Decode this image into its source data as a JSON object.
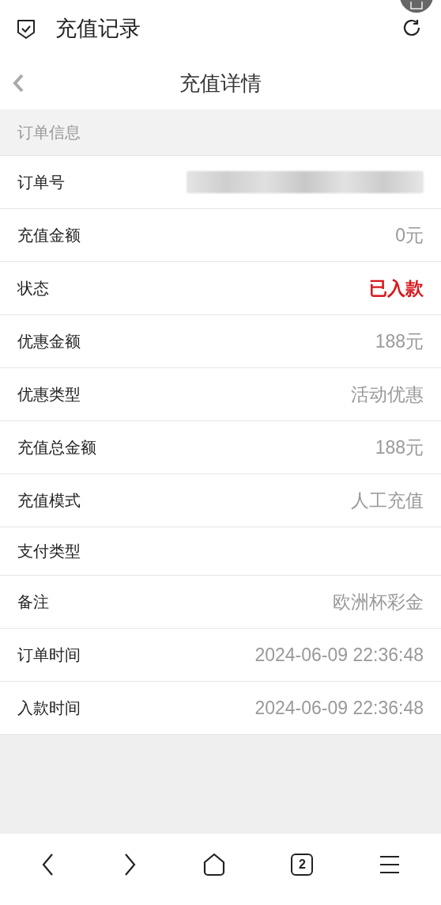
{
  "app_bar": {
    "title": "充值记录"
  },
  "header": {
    "title": "充值详情"
  },
  "section": {
    "title": "订单信息"
  },
  "rows": [
    {
      "label": "订单号",
      "kind": "masked"
    },
    {
      "label": "充值金额",
      "kind": "text",
      "value": "0元"
    },
    {
      "label": "状态",
      "kind": "status",
      "value": "已入款"
    },
    {
      "label": "优惠金额",
      "kind": "text",
      "value": "188元"
    },
    {
      "label": "优惠类型",
      "kind": "text",
      "value": "活动优惠"
    },
    {
      "label": "充值总金额",
      "kind": "text",
      "value": "188元"
    },
    {
      "label": "充值模式",
      "kind": "text",
      "value": "人工充值"
    },
    {
      "label": "支付类型",
      "kind": "empty"
    },
    {
      "label": "备注",
      "kind": "text",
      "value": "欧洲杯彩金"
    },
    {
      "label": "订单时间",
      "kind": "text",
      "value": "2024-06-09 22:36:48"
    },
    {
      "label": "入款时间",
      "kind": "text",
      "value": "2024-06-09 22:36:48"
    }
  ],
  "bottom_nav": {
    "tab_count": "2"
  }
}
